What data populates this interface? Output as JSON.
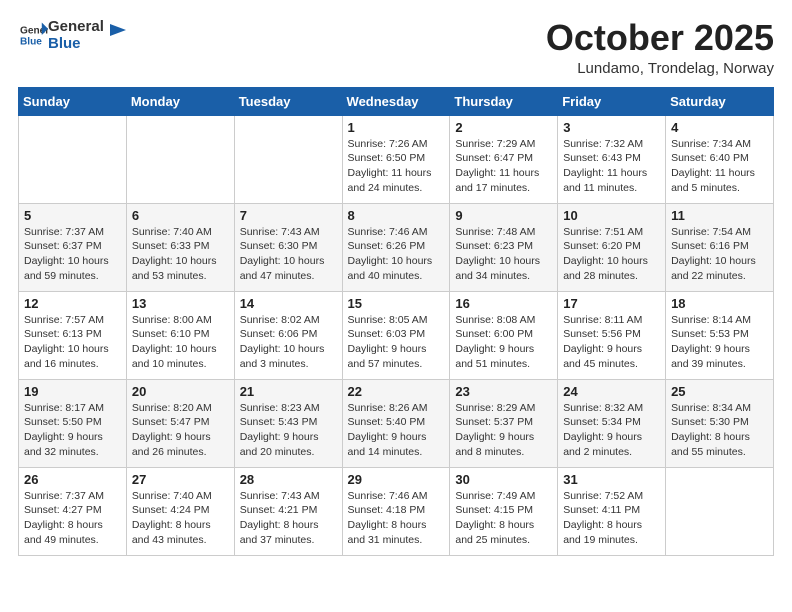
{
  "header": {
    "logo_general": "General",
    "logo_blue": "Blue",
    "month_title": "October 2025",
    "location": "Lundamo, Trondelag, Norway"
  },
  "weekdays": [
    "Sunday",
    "Monday",
    "Tuesday",
    "Wednesday",
    "Thursday",
    "Friday",
    "Saturday"
  ],
  "weeks": [
    [
      {
        "day": "",
        "info": ""
      },
      {
        "day": "",
        "info": ""
      },
      {
        "day": "",
        "info": ""
      },
      {
        "day": "1",
        "info": "Sunrise: 7:26 AM\nSunset: 6:50 PM\nDaylight: 11 hours\nand 24 minutes."
      },
      {
        "day": "2",
        "info": "Sunrise: 7:29 AM\nSunset: 6:47 PM\nDaylight: 11 hours\nand 17 minutes."
      },
      {
        "day": "3",
        "info": "Sunrise: 7:32 AM\nSunset: 6:43 PM\nDaylight: 11 hours\nand 11 minutes."
      },
      {
        "day": "4",
        "info": "Sunrise: 7:34 AM\nSunset: 6:40 PM\nDaylight: 11 hours\nand 5 minutes."
      }
    ],
    [
      {
        "day": "5",
        "info": "Sunrise: 7:37 AM\nSunset: 6:37 PM\nDaylight: 10 hours\nand 59 minutes."
      },
      {
        "day": "6",
        "info": "Sunrise: 7:40 AM\nSunset: 6:33 PM\nDaylight: 10 hours\nand 53 minutes."
      },
      {
        "day": "7",
        "info": "Sunrise: 7:43 AM\nSunset: 6:30 PM\nDaylight: 10 hours\nand 47 minutes."
      },
      {
        "day": "8",
        "info": "Sunrise: 7:46 AM\nSunset: 6:26 PM\nDaylight: 10 hours\nand 40 minutes."
      },
      {
        "day": "9",
        "info": "Sunrise: 7:48 AM\nSunset: 6:23 PM\nDaylight: 10 hours\nand 34 minutes."
      },
      {
        "day": "10",
        "info": "Sunrise: 7:51 AM\nSunset: 6:20 PM\nDaylight: 10 hours\nand 28 minutes."
      },
      {
        "day": "11",
        "info": "Sunrise: 7:54 AM\nSunset: 6:16 PM\nDaylight: 10 hours\nand 22 minutes."
      }
    ],
    [
      {
        "day": "12",
        "info": "Sunrise: 7:57 AM\nSunset: 6:13 PM\nDaylight: 10 hours\nand 16 minutes."
      },
      {
        "day": "13",
        "info": "Sunrise: 8:00 AM\nSunset: 6:10 PM\nDaylight: 10 hours\nand 10 minutes."
      },
      {
        "day": "14",
        "info": "Sunrise: 8:02 AM\nSunset: 6:06 PM\nDaylight: 10 hours\nand 3 minutes."
      },
      {
        "day": "15",
        "info": "Sunrise: 8:05 AM\nSunset: 6:03 PM\nDaylight: 9 hours\nand 57 minutes."
      },
      {
        "day": "16",
        "info": "Sunrise: 8:08 AM\nSunset: 6:00 PM\nDaylight: 9 hours\nand 51 minutes."
      },
      {
        "day": "17",
        "info": "Sunrise: 8:11 AM\nSunset: 5:56 PM\nDaylight: 9 hours\nand 45 minutes."
      },
      {
        "day": "18",
        "info": "Sunrise: 8:14 AM\nSunset: 5:53 PM\nDaylight: 9 hours\nand 39 minutes."
      }
    ],
    [
      {
        "day": "19",
        "info": "Sunrise: 8:17 AM\nSunset: 5:50 PM\nDaylight: 9 hours\nand 32 minutes."
      },
      {
        "day": "20",
        "info": "Sunrise: 8:20 AM\nSunset: 5:47 PM\nDaylight: 9 hours\nand 26 minutes."
      },
      {
        "day": "21",
        "info": "Sunrise: 8:23 AM\nSunset: 5:43 PM\nDaylight: 9 hours\nand 20 minutes."
      },
      {
        "day": "22",
        "info": "Sunrise: 8:26 AM\nSunset: 5:40 PM\nDaylight: 9 hours\nand 14 minutes."
      },
      {
        "day": "23",
        "info": "Sunrise: 8:29 AM\nSunset: 5:37 PM\nDaylight: 9 hours\nand 8 minutes."
      },
      {
        "day": "24",
        "info": "Sunrise: 8:32 AM\nSunset: 5:34 PM\nDaylight: 9 hours\nand 2 minutes."
      },
      {
        "day": "25",
        "info": "Sunrise: 8:34 AM\nSunset: 5:30 PM\nDaylight: 8 hours\nand 55 minutes."
      }
    ],
    [
      {
        "day": "26",
        "info": "Sunrise: 7:37 AM\nSunset: 4:27 PM\nDaylight: 8 hours\nand 49 minutes."
      },
      {
        "day": "27",
        "info": "Sunrise: 7:40 AM\nSunset: 4:24 PM\nDaylight: 8 hours\nand 43 minutes."
      },
      {
        "day": "28",
        "info": "Sunrise: 7:43 AM\nSunset: 4:21 PM\nDaylight: 8 hours\nand 37 minutes."
      },
      {
        "day": "29",
        "info": "Sunrise: 7:46 AM\nSunset: 4:18 PM\nDaylight: 8 hours\nand 31 minutes."
      },
      {
        "day": "30",
        "info": "Sunrise: 7:49 AM\nSunset: 4:15 PM\nDaylight: 8 hours\nand 25 minutes."
      },
      {
        "day": "31",
        "info": "Sunrise: 7:52 AM\nSunset: 4:11 PM\nDaylight: 8 hours\nand 19 minutes."
      },
      {
        "day": "",
        "info": ""
      }
    ]
  ]
}
